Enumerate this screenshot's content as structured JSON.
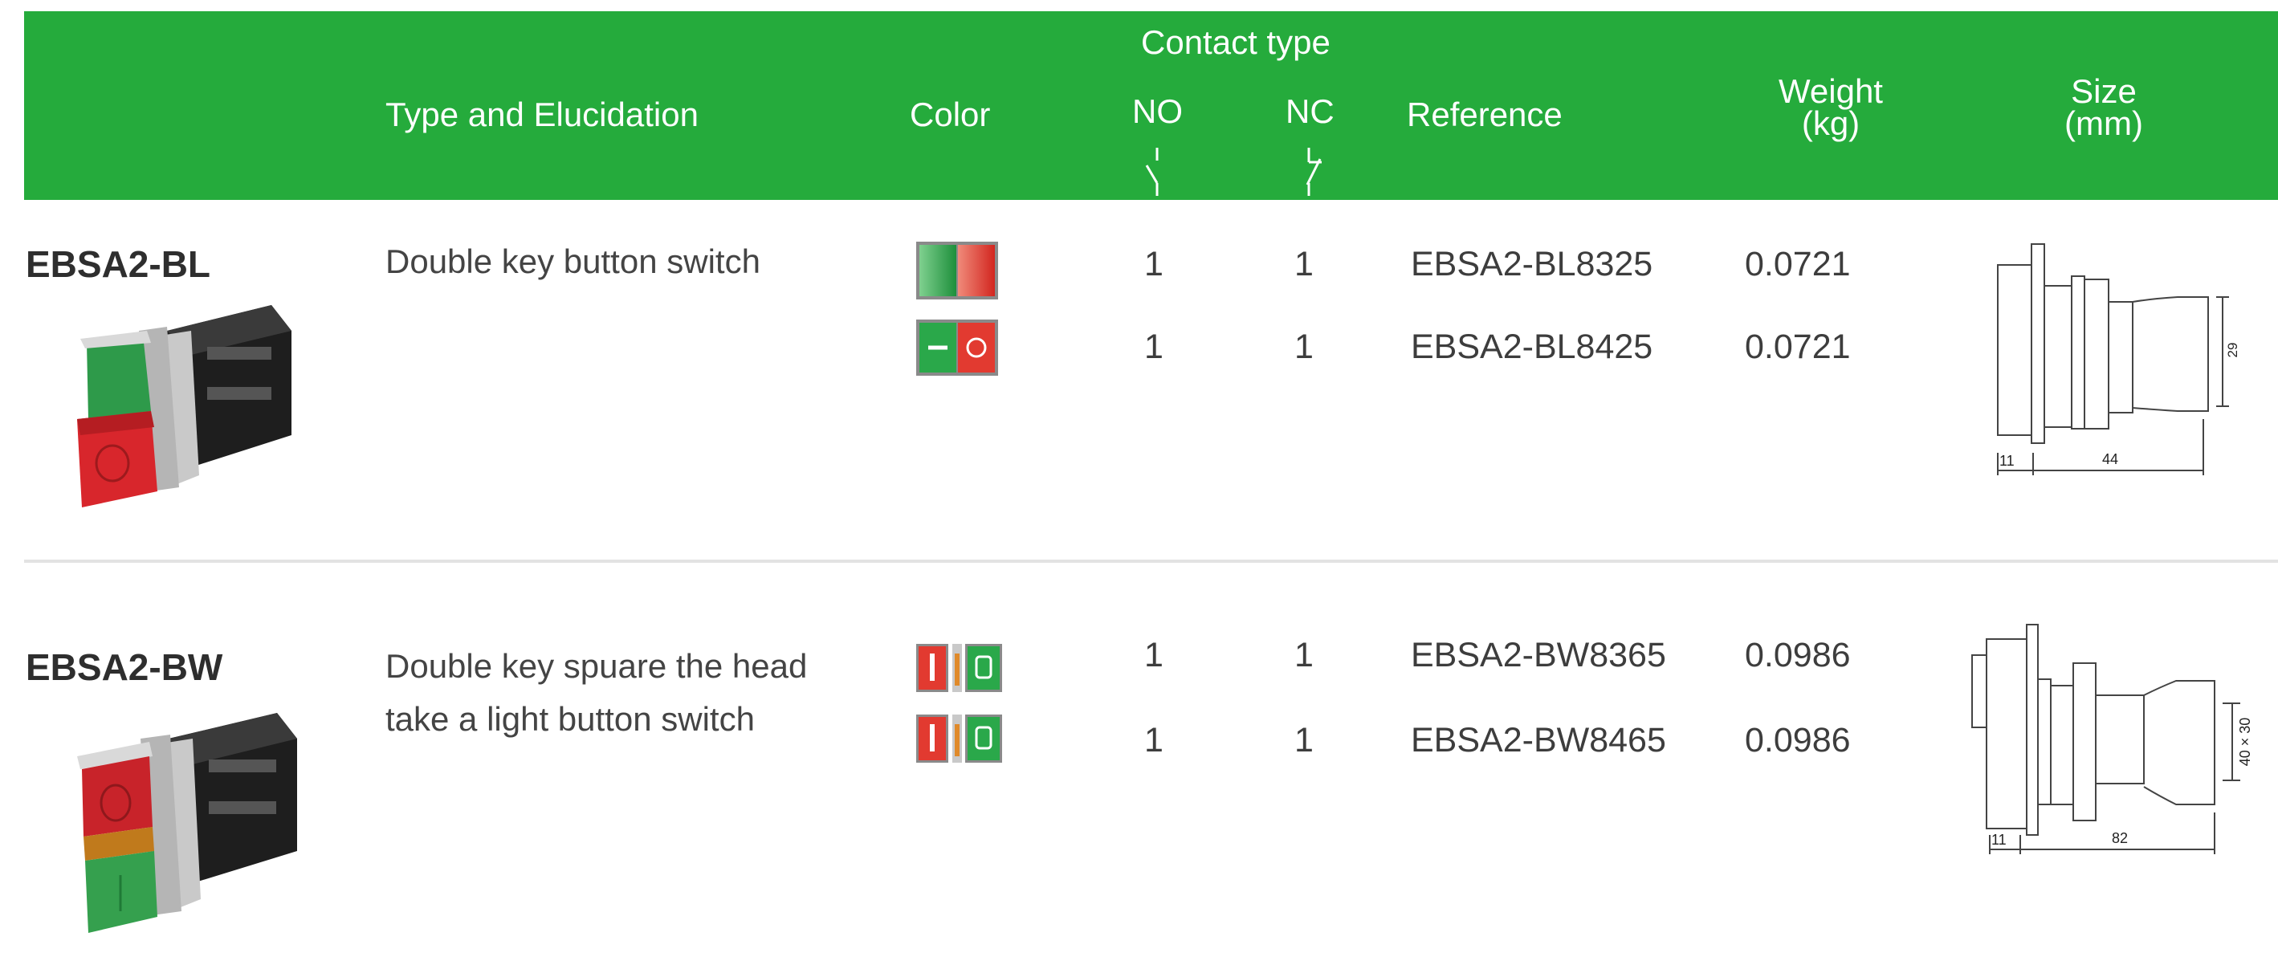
{
  "header": {
    "contact_type": "Contact type",
    "type": "Type and Elucidation",
    "color": "Color",
    "no": "NO",
    "nc": "NC",
    "reference": "Reference",
    "weight_line1": "Weight",
    "weight_line2": "(kg)",
    "size_line1": "Size",
    "size_line2": "(mm)"
  },
  "colors": {
    "header_green": "#25ab3c",
    "button_green": "#2aa84a",
    "button_red": "#e23a30",
    "button_amber": "#e08a2a"
  },
  "products": [
    {
      "model": "EBSA2-BL",
      "description_lines": [
        "Double key button switch"
      ],
      "rows": [
        {
          "no": "1",
          "nc": "1",
          "reference": "EBSA2-BL8325",
          "weight": "0.0721",
          "swatch": "green-red-plain"
        },
        {
          "no": "1",
          "nc": "1",
          "reference": "EBSA2-BL8425",
          "weight": "0.0721",
          "swatch": "green-red-marked"
        }
      ],
      "drawing": {
        "dim_a": "11",
        "dim_b": "44",
        "dim_h": "29"
      }
    },
    {
      "model": "EBSA2-BW",
      "description_lines": [
        "Double key spuare the head",
        "take a light button switch"
      ],
      "rows": [
        {
          "no": "1",
          "nc": "1",
          "reference": "EBSA2-BW8365",
          "weight": "0.0986",
          "swatch": "red-amber-green"
        },
        {
          "no": "1",
          "nc": "1",
          "reference": "EBSA2-BW8465",
          "weight": "0.0986",
          "swatch": "red-amber-green"
        }
      ],
      "drawing": {
        "dim_a": "11",
        "dim_b": "82",
        "dim_h": "40 × 30"
      }
    }
  ]
}
